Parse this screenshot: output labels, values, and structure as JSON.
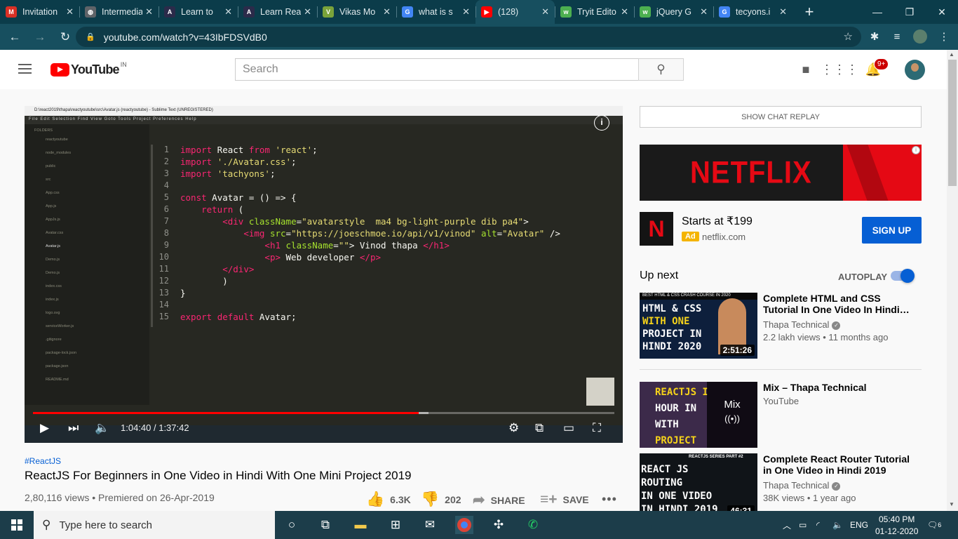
{
  "browser": {
    "tabs": [
      {
        "title": "Invitation",
        "icon": "gmail-icon",
        "color": "#d93025",
        "glyph": "M"
      },
      {
        "title": "Intermediate",
        "icon": "globe-icon",
        "color": "#5f6368",
        "glyph": "◍"
      },
      {
        "title": "Learn to",
        "icon": "ap-icon",
        "color": "#2b2b4a",
        "glyph": "A"
      },
      {
        "title": "Learn React",
        "icon": "ap-icon",
        "color": "#2b2b4a",
        "glyph": "A"
      },
      {
        "title": "Vikas Mo",
        "icon": "avatar-icon",
        "color": "#7aa33a",
        "glyph": "V"
      },
      {
        "title": "what is s",
        "icon": "google-icon",
        "color": "#4285f4",
        "glyph": "G"
      },
      {
        "title": "(128)",
        "icon": "youtube-icon",
        "color": "#ff0000",
        "glyph": "▶",
        "active": true
      },
      {
        "title": "Tryit Edito",
        "icon": "w3schools-icon",
        "color": "#4caf50",
        "glyph": "w"
      },
      {
        "title": "jQuery G",
        "icon": "w3schools-icon",
        "color": "#4caf50",
        "glyph": "w"
      },
      {
        "title": "tecyons.i",
        "icon": "google-icon",
        "color": "#4285f4",
        "glyph": "G"
      }
    ],
    "new_tab": "+",
    "url": "youtube.com/watch?v=43IbFDSVdB0"
  },
  "youtube": {
    "logo_text": "YouTube",
    "country": "IN",
    "search_placeholder": "Search",
    "notification_count": "9+"
  },
  "player": {
    "time": "1:04:40 / 1:37:42",
    "progress_played": 0.663,
    "progress_loaded": 0.68,
    "code_lines": [
      {
        "n": "1",
        "html": "<span class='k'>import</span> React <span class='k'>from</span> <span class='s'>'react'</span>;"
      },
      {
        "n": "2",
        "html": "<span class='k'>import</span> <span class='s'>'./Avatar.css'</span>;"
      },
      {
        "n": "3",
        "html": "<span class='k'>import</span> <span class='s'>'tachyons'</span>;"
      },
      {
        "n": "4",
        "html": ""
      },
      {
        "n": "5",
        "html": "<span class='k'>const</span> Avatar = () => {"
      },
      {
        "n": "6",
        "html": "    <span class='k'>return</span> ("
      },
      {
        "n": "7",
        "html": "        <span class='k'>&lt;div</span> <span class='a'>className</span>=<span class='s'>\"avatarstyle  ma4 bg-light-purple dib pa4\"</span>&gt;"
      },
      {
        "n": "8",
        "html": "            <span class='k'>&lt;img</span> <span class='a'>src</span>=<span class='s'>\"https://joeschmoe.io/api/v1/vinod\"</span> <span class='a'>alt</span>=<span class='s'>\"Avatar\"</span> /&gt;"
      },
      {
        "n": "9",
        "html": "                <span class='k'>&lt;h1</span> <span class='a'>className</span>=<span class='s'>\"\"</span>&gt; Vinod thapa <span class='k'>&lt;/h1&gt;</span>"
      },
      {
        "n": "10",
        "html": "                <span class='k'>&lt;p&gt;</span> Web developer <span class='k'>&lt;/p&gt;</span>"
      },
      {
        "n": "11",
        "html": "        <span class='k'>&lt;/div&gt;</span>"
      },
      {
        "n": "12",
        "html": "        )"
      },
      {
        "n": "13",
        "html": "}"
      },
      {
        "n": "14",
        "html": ""
      },
      {
        "n": "15",
        "html": "<span class='k'>export</span> <span class='k'>default</span> Avatar;"
      }
    ]
  },
  "video": {
    "hashtag": "#ReactJS",
    "title": "ReactJS For Beginners in One Video in Hindi With One Mini Project 2019",
    "meta": "2,80,116 views • Premiered on 26-Apr-2019",
    "likes": "6.3K",
    "dislikes": "202",
    "share": "SHARE",
    "save": "SAVE"
  },
  "sidebar": {
    "chat_replay": "SHOW CHAT REPLAY",
    "ad": {
      "banner_text": "NETFLIX",
      "title": "Starts at ₹199",
      "tag": "Ad",
      "site": "netflix.com",
      "cta": "SIGN UP"
    },
    "up_next": "Up next",
    "autoplay": "AUTOPLAY",
    "recommendations": [
      {
        "title": "Complete HTML and CSS Tutorial In One Video In Hindi…",
        "channel": "Thapa Technical",
        "verified": true,
        "meta": "2.2 lakh views • 11 months ago",
        "duration": "2:51:26"
      },
      {
        "title": "Mix – Thapa Technical",
        "channel": "YouTube",
        "verified": false,
        "meta": "",
        "duration": ""
      },
      {
        "title": "Complete React Router Tutorial in One Video in Hindi 2019",
        "channel": "Thapa Technical",
        "verified": true,
        "meta": "38K views • 1 year ago",
        "duration": "46:31"
      }
    ]
  },
  "taskbar": {
    "search_placeholder": "Type here to search",
    "lang": "ENG",
    "time": "05:40 PM",
    "date": "01-12-2020",
    "notif_count": "6"
  }
}
